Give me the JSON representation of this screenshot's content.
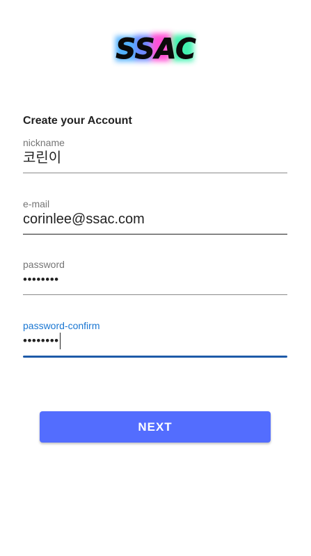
{
  "logo": {
    "text": "SSAC"
  },
  "form": {
    "heading": "Create your Account",
    "nickname": {
      "label": "nickname",
      "value": "코린이"
    },
    "email": {
      "label": "e-mail",
      "value": "corinlee@ssac.com"
    },
    "password": {
      "label": "password",
      "value": "••••••••"
    },
    "password_confirm": {
      "label": "password-confirm",
      "value": "••••••••"
    }
  },
  "actions": {
    "next_label": "NEXT"
  },
  "colors": {
    "accent": "#536dfe",
    "focus": "#1976d2",
    "focus_underline": "#1e5aa8",
    "label": "#757575",
    "text": "#212121"
  }
}
